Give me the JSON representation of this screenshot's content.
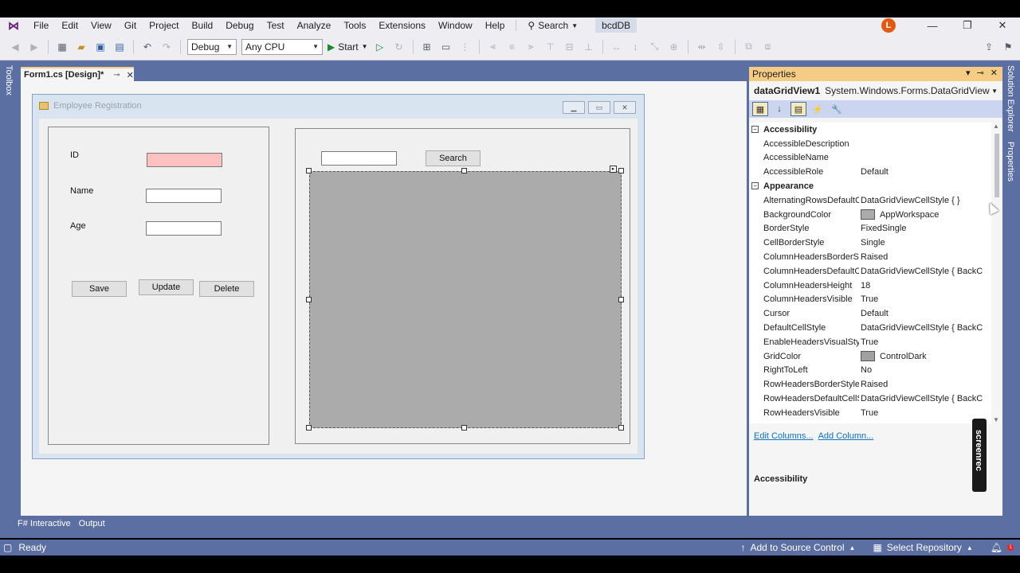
{
  "menu": {
    "items": [
      "File",
      "Edit",
      "View",
      "Git",
      "Project",
      "Build",
      "Debug",
      "Test",
      "Analyze",
      "Tools",
      "Extensions",
      "Window",
      "Help"
    ],
    "search_label": "Search",
    "solution_name": "bcdDB",
    "user_initial": "L"
  },
  "toolbar": {
    "configuration": "Debug",
    "platform": "Any CPU",
    "start_label": "Start"
  },
  "side_tabs": {
    "left": "Toolbox",
    "right_1": "Solution Explorer",
    "right_2": "Properties"
  },
  "document_tab": {
    "title": "Form1.cs [Design]*"
  },
  "form": {
    "title": "Employee Registration",
    "labels": {
      "id": "ID",
      "name": "Name",
      "age": "Age"
    },
    "buttons": {
      "save": "Save",
      "update": "Update",
      "delete": "Delete",
      "search": "Search"
    }
  },
  "properties": {
    "header": "Properties",
    "object_name": "dataGridView1",
    "object_type": "System.Windows.Forms.DataGridView",
    "rows": [
      {
        "type": "category",
        "name": "Accessibility"
      },
      {
        "type": "prop",
        "name": "AccessibleDescription",
        "value": ""
      },
      {
        "type": "prop",
        "name": "AccessibleName",
        "value": ""
      },
      {
        "type": "prop",
        "name": "AccessibleRole",
        "value": "Default"
      },
      {
        "type": "category",
        "name": "Appearance"
      },
      {
        "type": "prop",
        "name": "AlternatingRowsDefaultCel",
        "value": "DataGridViewCellStyle { }"
      },
      {
        "type": "prop",
        "name": "BackgroundColor",
        "value": "AppWorkspace",
        "swatch": "#ababab"
      },
      {
        "type": "prop",
        "name": "BorderStyle",
        "value": "FixedSingle"
      },
      {
        "type": "prop",
        "name": "CellBorderStyle",
        "value": "Single"
      },
      {
        "type": "prop",
        "name": "ColumnHeadersBorderStyl",
        "value": "Raised"
      },
      {
        "type": "prop",
        "name": "ColumnHeadersDefaultCel",
        "value": "DataGridViewCellStyle { BackC"
      },
      {
        "type": "prop",
        "name": "ColumnHeadersHeight",
        "value": "18"
      },
      {
        "type": "prop",
        "name": "ColumnHeadersVisible",
        "value": "True"
      },
      {
        "type": "prop",
        "name": "Cursor",
        "value": "Default"
      },
      {
        "type": "prop",
        "name": "DefaultCellStyle",
        "value": "DataGridViewCellStyle { BackC"
      },
      {
        "type": "prop",
        "name": "EnableHeadersVisualStyles",
        "value": "True"
      },
      {
        "type": "prop",
        "name": "GridColor",
        "value": "ControlDark",
        "swatch": "#a0a0a0"
      },
      {
        "type": "prop",
        "name": "RightToLeft",
        "value": "No"
      },
      {
        "type": "prop",
        "name": "RowHeadersBorderStyle",
        "value": "Raised"
      },
      {
        "type": "prop",
        "name": "RowHeadersDefaultCellSty",
        "value": "DataGridViewCellStyle { BackC"
      },
      {
        "type": "prop",
        "name": "RowHeadersVisible",
        "value": "True"
      }
    ],
    "links": {
      "edit_columns": "Edit Columns...",
      "add_column": "Add Column..."
    },
    "description_title": "Accessibility"
  },
  "watermark": "screenrec",
  "bottom_tabs": [
    "F# Interactive",
    "Output"
  ],
  "status": {
    "ready": "Ready",
    "source_control": "Add to Source Control",
    "repository": "Select Repository",
    "notification_count": "1"
  },
  "colors": {
    "frame": "#5c6fa3",
    "active_tab_accent": "#f5cc84",
    "id_textbox": "#ffc0c0",
    "grid_background": "#ababab"
  }
}
